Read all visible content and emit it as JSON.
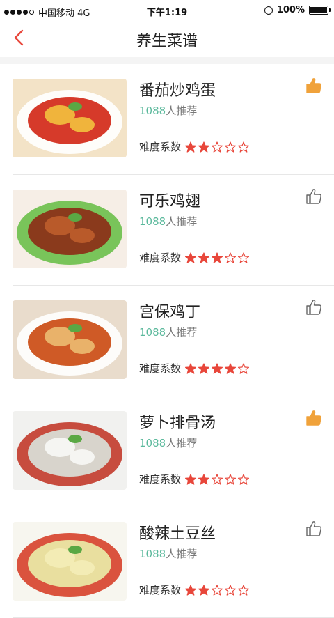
{
  "status": {
    "carrier": "中国移动 4G",
    "time": "下午1:19",
    "battery": "100%"
  },
  "header": {
    "title": "养生菜谱"
  },
  "recipes": [
    {
      "name": "番茄炒鸡蛋",
      "count": "1088",
      "rec_suffix": "人推荐",
      "difficulty_label": "难度系数",
      "stars": 2,
      "liked": true
    },
    {
      "name": "可乐鸡翅",
      "count": "1088",
      "rec_suffix": "人推荐",
      "difficulty_label": "难度系数",
      "stars": 3,
      "liked": false
    },
    {
      "name": "宫保鸡丁",
      "count": "1088",
      "rec_suffix": "人推荐",
      "difficulty_label": "难度系数",
      "stars": 4,
      "liked": false
    },
    {
      "name": "萝卜排骨汤",
      "count": "1088",
      "rec_suffix": "人推荐",
      "difficulty_label": "难度系数",
      "stars": 2,
      "liked": true
    },
    {
      "name": "酸辣土豆丝",
      "count": "1088",
      "rec_suffix": "人推荐",
      "difficulty_label": "难度系数",
      "stars": 2,
      "liked": false
    }
  ],
  "colors": {
    "accent": "#e8473b",
    "like_active": "#f0a23b",
    "count": "#5bb99c"
  }
}
